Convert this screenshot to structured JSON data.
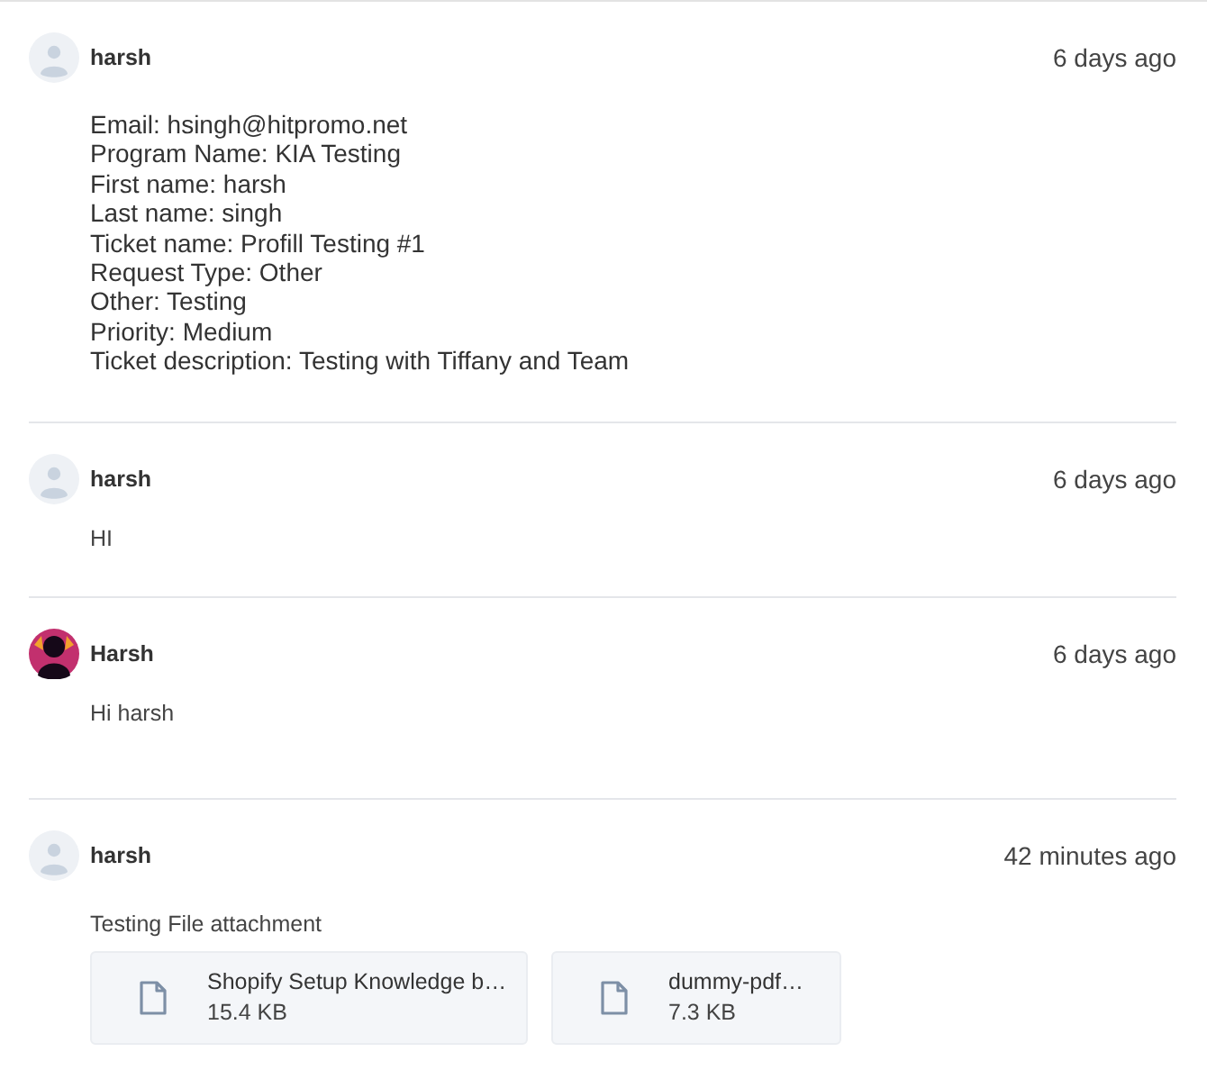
{
  "messages": [
    {
      "author": "harsh",
      "avatar": {
        "kind": "placeholder"
      },
      "time": "6 days ago",
      "lines": [
        "Email: hsingh@hitpromo.net",
        "Program Name: KIA Testing",
        "First name: harsh",
        "Last name: singh",
        "Ticket name: Profill Testing #1",
        "Request Type: Other",
        "Other: Testing",
        "Priority: Medium",
        "Ticket description: Testing with Tiffany and Team"
      ]
    },
    {
      "author": "harsh",
      "avatar": {
        "kind": "placeholder"
      },
      "time": "6 days ago",
      "text": "HI"
    },
    {
      "author": "Harsh",
      "avatar": {
        "kind": "picture"
      },
      "time": "6 days ago",
      "text": "Hi harsh"
    },
    {
      "author": "harsh",
      "avatar": {
        "kind": "placeholder"
      },
      "time": "42 minutes ago",
      "text": "Testing File attachment",
      "attachments": [
        {
          "name": "Shopify Setup Knowledge b…",
          "size": "15.4 KB"
        },
        {
          "name": "dummy-pdf…",
          "size": "7.3 KB"
        }
      ]
    }
  ]
}
